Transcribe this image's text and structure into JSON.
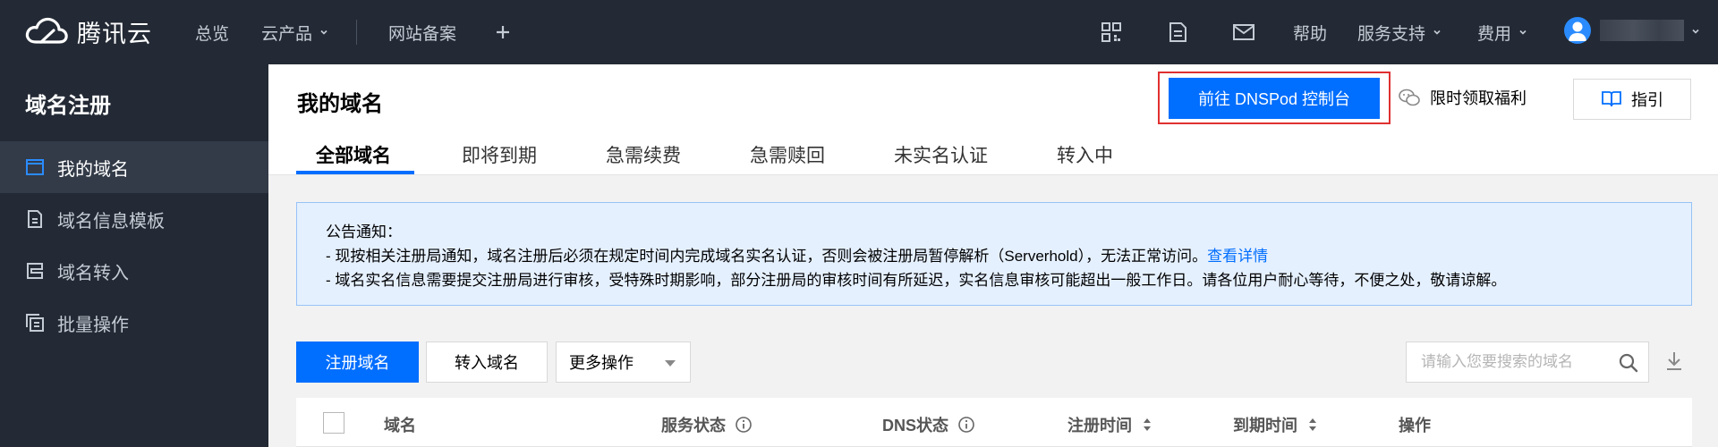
{
  "header": {
    "brand": "腾讯云",
    "nav": [
      {
        "label": "总览"
      },
      {
        "label": "云产品"
      },
      {
        "label": "网站备案"
      }
    ],
    "right": {
      "help": "帮助",
      "support": "服务支持",
      "billing": "费用"
    },
    "icons": [
      "qrcode-icon",
      "document-icon",
      "mail-icon",
      "plus-icon",
      "user-icon"
    ]
  },
  "sidebar": {
    "title": "域名注册",
    "items": [
      {
        "label": "我的域名",
        "icon": "domain-icon",
        "active": true
      },
      {
        "label": "域名信息模板",
        "icon": "template-icon"
      },
      {
        "label": "域名转入",
        "icon": "transfer-icon"
      },
      {
        "label": "批量操作",
        "icon": "batch-icon"
      }
    ]
  },
  "main": {
    "title": "我的域名",
    "dnspod_button": "前往 DNSPod 控制台",
    "benefit_link": "限时领取福利",
    "guide_button": "指引",
    "tabs": [
      {
        "label": "全部域名",
        "active": true
      },
      {
        "label": "即将到期"
      },
      {
        "label": "急需续费"
      },
      {
        "label": "急需赎回"
      },
      {
        "label": "未实名认证"
      },
      {
        "label": "转入中"
      }
    ],
    "notice": {
      "title": "公告通知：",
      "line1": "- 现按相关注册局通知，域名注册后必须在规定时间内完成域名实名认证，否则会被注册局暂停解析（Serverhold），无法正常访问。",
      "line1_link": "查看详情",
      "line2": "- 域名实名信息需要提交注册局进行审核，受特殊时期影响，部分注册局的审核时间有所延迟，实名信息审核可能超出一般工作日。请各位用户耐心等待，不便之处，敬请谅解。"
    },
    "toolbar": {
      "register": "注册域名",
      "transfer": "转入域名",
      "more": "更多操作",
      "search_placeholder": "请输入您要搜索的域名"
    },
    "table": {
      "columns": [
        "域名",
        "服务状态",
        "DNS状态",
        "注册时间",
        "到期时间",
        "操作"
      ]
    }
  },
  "colors": {
    "nav_bg": "#232a35",
    "primary": "#006eff",
    "highlight_border": "#e03030",
    "notice_bg": "#e5f0ff"
  }
}
